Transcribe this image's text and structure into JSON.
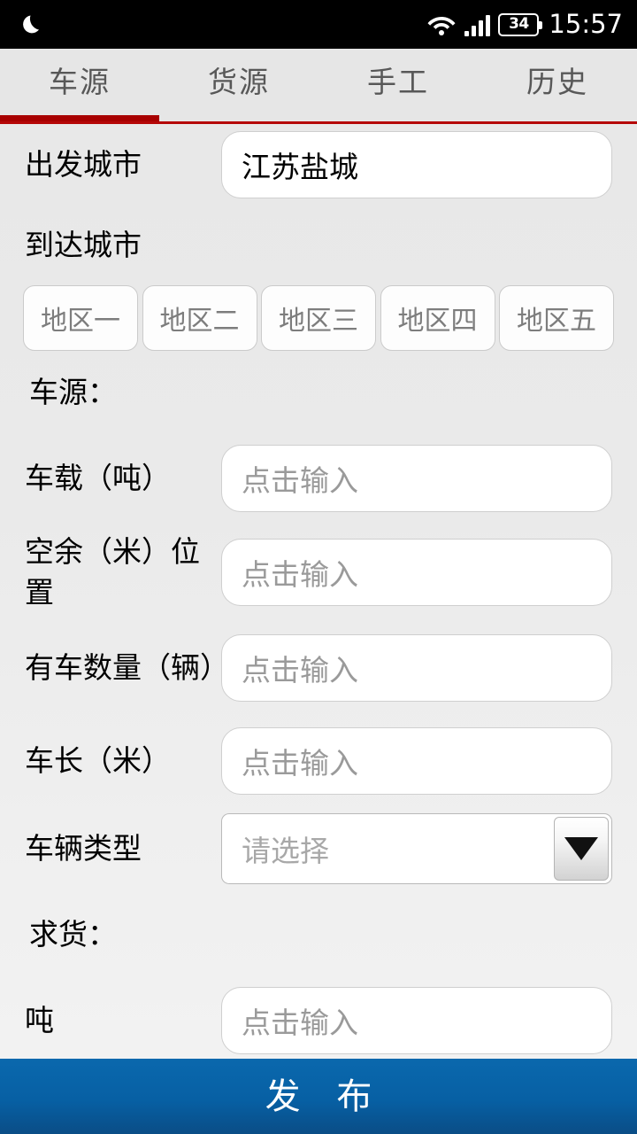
{
  "status_bar": {
    "dnd_icon": "moon-icon",
    "wifi_icon": "wifi-icon",
    "signal_icon": "signal-bars-icon",
    "battery_icon": "battery-icon",
    "battery_level": "34",
    "time": "15:57"
  },
  "tabs": [
    {
      "label": "车源",
      "active": true
    },
    {
      "label": "货源",
      "active": false
    },
    {
      "label": "手工",
      "active": false
    },
    {
      "label": "历史",
      "active": false
    }
  ],
  "theme": {
    "tab_indicator": "#a80000",
    "tab_line": "#b50707",
    "publish_blue": "#0760a4",
    "page_bg": "#ececec"
  },
  "form": {
    "departure": {
      "label": "出发城市",
      "value": "江苏盐城"
    },
    "arrival": {
      "label": "到达城市",
      "regions": [
        "地区一",
        "地区二",
        "地区三",
        "地区四",
        "地区五"
      ]
    },
    "vehicle_section": {
      "title": "车源：",
      "fields": [
        {
          "label": "车载（吨）",
          "placeholder": "点击输入",
          "value": "",
          "type": "input"
        },
        {
          "label": "空余（米）位置",
          "placeholder": "点击输入",
          "value": "",
          "type": "input"
        },
        {
          "label": "有车数量（辆）",
          "placeholder": "点击输入",
          "value": "",
          "type": "input"
        },
        {
          "label": "车长（米）",
          "placeholder": "点击输入",
          "value": "",
          "type": "input"
        },
        {
          "label": "车辆类型",
          "placeholder": "请选择",
          "value": "",
          "type": "select"
        }
      ]
    },
    "cargo_section": {
      "title": "求货：",
      "fields": [
        {
          "label": "吨",
          "placeholder": "点击输入",
          "value": "",
          "type": "input"
        }
      ]
    }
  },
  "publish_button": {
    "label": "发 布"
  }
}
